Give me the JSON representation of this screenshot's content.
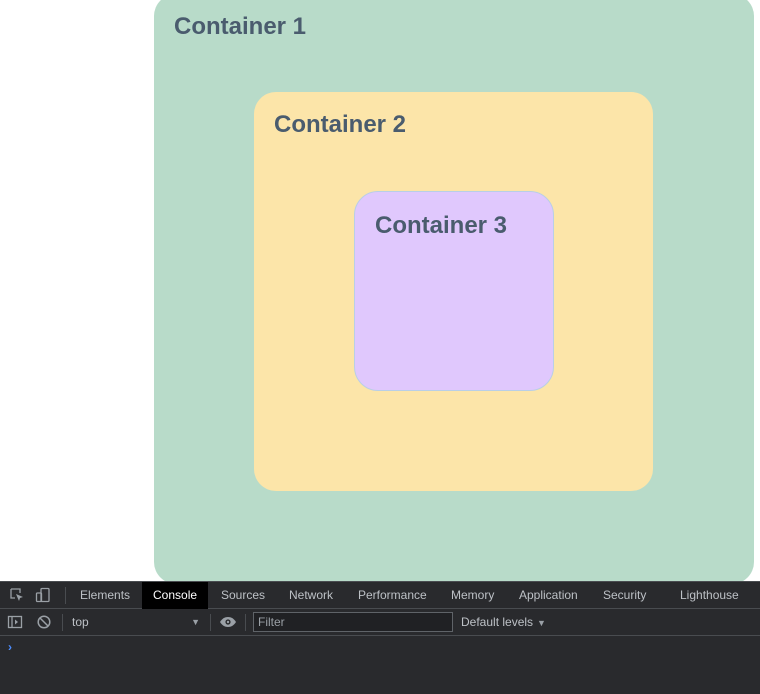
{
  "containers": {
    "c1": {
      "title": "Container 1",
      "color": "#b8dbc9"
    },
    "c2": {
      "title": "Container 2",
      "color": "#fce5a9"
    },
    "c3": {
      "title": "Container 3",
      "color": "#e0c8fd"
    }
  },
  "devtools": {
    "tabs": [
      "Elements",
      "Console",
      "Sources",
      "Network",
      "Performance",
      "Memory",
      "Application",
      "Security",
      "Lighthouse"
    ],
    "active_tab": "Console",
    "context": {
      "value": "top"
    },
    "filter": {
      "placeholder": "Filter"
    },
    "levels": {
      "label": "Default levels"
    },
    "prompt": "›",
    "icons": [
      "inspect-element-icon",
      "device-toolbar-icon",
      "sidebar-toggle-icon",
      "clear-console-icon",
      "eye-icon"
    ]
  }
}
